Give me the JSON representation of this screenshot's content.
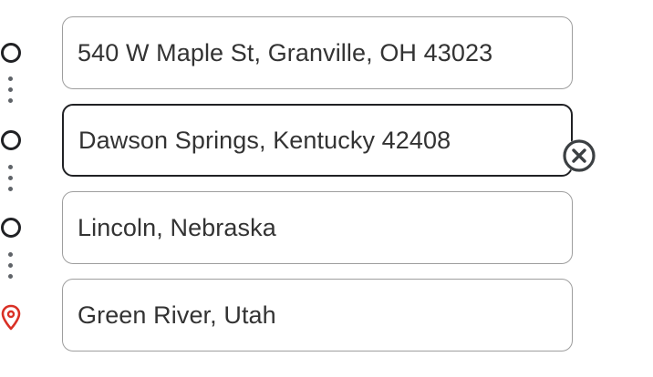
{
  "route": {
    "stops": [
      {
        "value": "540 W Maple St, Granville, OH 43023",
        "marker": "circle-icon"
      },
      {
        "value": "Dawson Springs, Kentucky 42408",
        "marker": "circle-icon",
        "focused": true
      },
      {
        "value": "Lincoln, Nebraska",
        "marker": "circle-icon"
      },
      {
        "value": "Green River, Utah",
        "marker": "location-pin-icon"
      }
    ],
    "remove_icon": "close-circle-icon",
    "colors": {
      "pin": "#d93025",
      "focused_border": "#202124",
      "border": "#9e9e9e",
      "text": "#333333"
    }
  }
}
